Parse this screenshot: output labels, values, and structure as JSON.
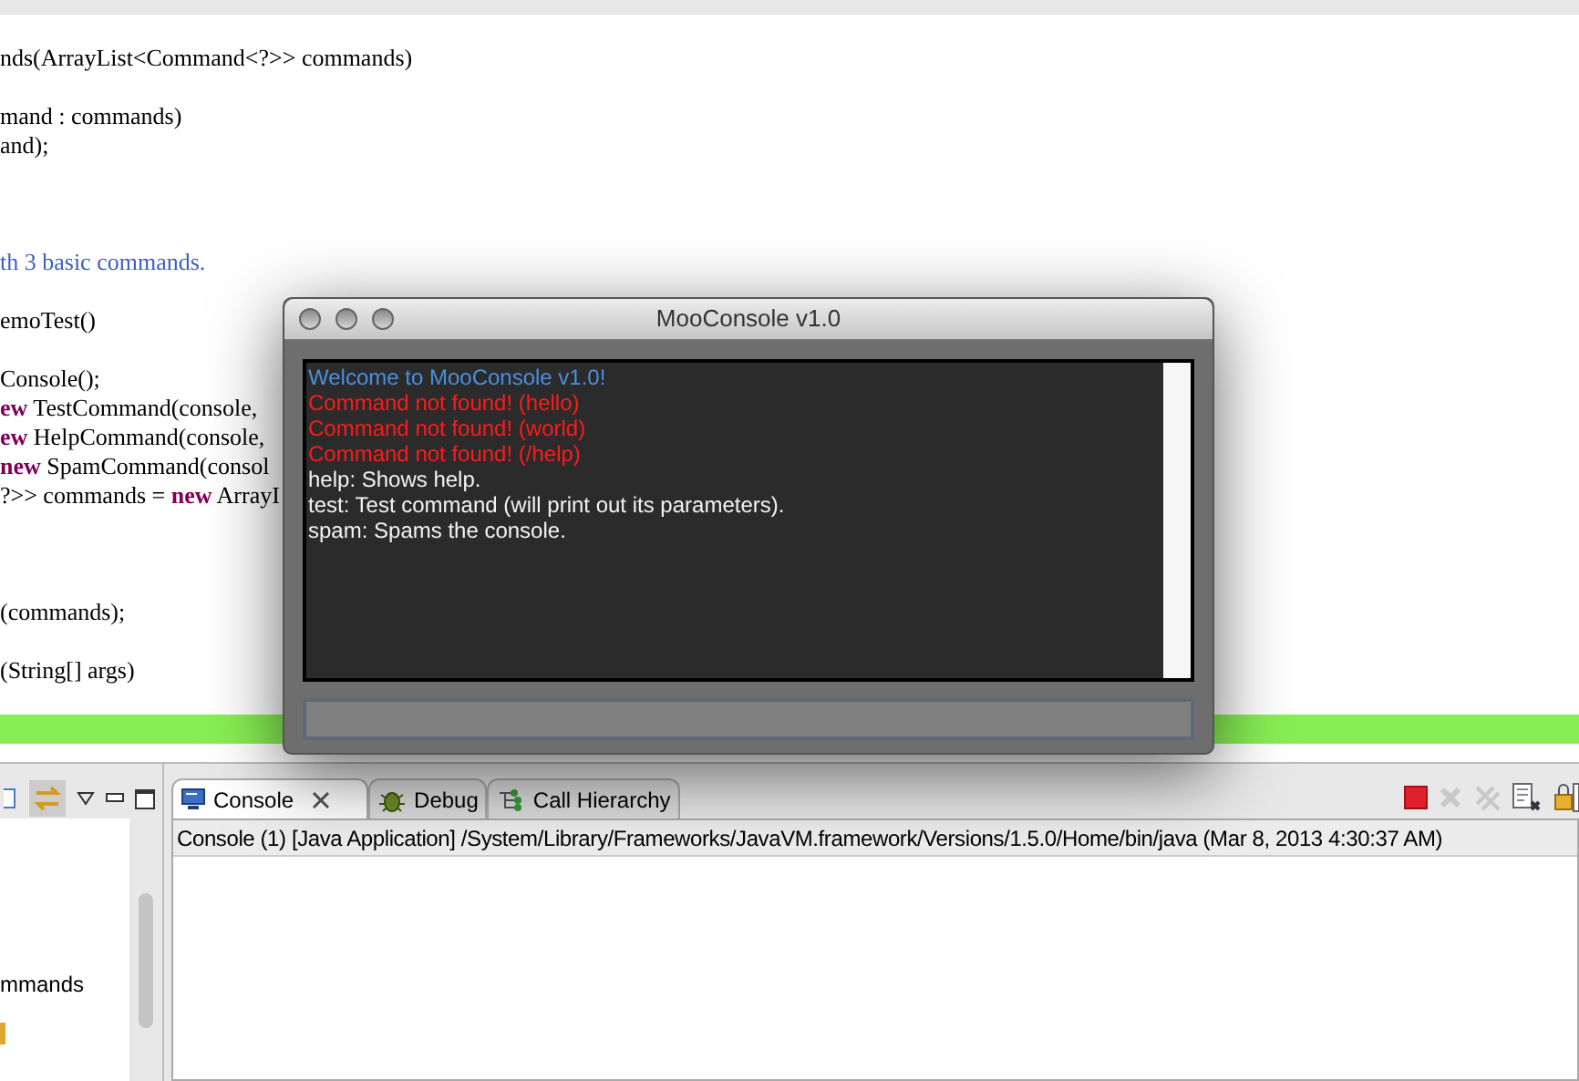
{
  "editor": {
    "lines": [
      {
        "current": false,
        "segments": [
          {
            "text": "nds(ArrayList<Command<?>> commands)",
            "kind": "plain"
          }
        ]
      },
      {
        "current": false
      },
      {
        "current": false,
        "segments": [
          {
            "text": "mand : commands)",
            "kind": "plain"
          }
        ]
      },
      {
        "current": false,
        "segments": [
          {
            "text": "and);",
            "kind": "plain"
          }
        ]
      },
      {
        "current": false
      },
      {
        "current": false
      },
      {
        "current": false
      },
      {
        "current": false,
        "segments": [
          {
            "text": "th 3 basic commands.",
            "kind": "comment"
          }
        ]
      },
      {
        "current": false
      },
      {
        "current": false,
        "segments": [
          {
            "text": "emoTest()",
            "kind": "plain"
          }
        ]
      },
      {
        "current": false
      },
      {
        "current": false,
        "segments": [
          {
            "text": "Console();",
            "kind": "plain"
          }
        ]
      },
      {
        "current": false,
        "segments": [
          {
            "text": "ew",
            "kind": "keyword"
          },
          {
            "text": " TestCommand(console,",
            "kind": "plain"
          }
        ]
      },
      {
        "current": false,
        "segments": [
          {
            "text": "ew",
            "kind": "keyword"
          },
          {
            "text": " HelpCommand(console,",
            "kind": "plain"
          }
        ]
      },
      {
        "current": false,
        "segments": [
          {
            "text": "new",
            "kind": "keyword"
          },
          {
            "text": " SpamCommand(consol",
            "kind": "plain"
          }
        ]
      },
      {
        "current": false,
        "segments": [
          {
            "text": "?>> commands = ",
            "kind": "plain"
          },
          {
            "text": "new",
            "kind": "keyword"
          },
          {
            "text": " ArrayI",
            "kind": "plain"
          }
        ]
      },
      {
        "current": false
      },
      {
        "current": false
      },
      {
        "current": false
      },
      {
        "current": false,
        "segments": [
          {
            "text": "(commands);",
            "kind": "plain"
          }
        ]
      },
      {
        "current": false
      },
      {
        "current": false,
        "segments": [
          {
            "text": "(String[] args)",
            "kind": "plain"
          }
        ]
      },
      {
        "current": false
      },
      {
        "current": true
      }
    ]
  },
  "dialog": {
    "title": "MooConsole v1.0",
    "log": [
      {
        "text": "Welcome to MooConsole v1.0!",
        "color": "#4a8fe0"
      },
      {
        "text": "Command not found! (hello)",
        "color": "#ff1a1a"
      },
      {
        "text": "Command not found! (world)",
        "color": "#ff1a1a"
      },
      {
        "text": "Command not found! (/help)",
        "color": "#ff1a1a"
      },
      {
        "text": "help: Shows help.",
        "color": "#f2f2f2"
      },
      {
        "text": "test: Test command (will print out its parameters).",
        "color": "#f2f2f2"
      },
      {
        "text": "spam: Spams the console.",
        "color": "#f2f2f2"
      }
    ]
  },
  "left_panel": {
    "item": "mmands"
  },
  "console_view": {
    "tabs": [
      {
        "label": "Console",
        "selected": true,
        "kind": "console"
      },
      {
        "label": "Debug",
        "selected": false,
        "kind": "debug"
      },
      {
        "label": "Call Hierarchy",
        "selected": false,
        "kind": "hierarchy"
      }
    ],
    "description": "Console (1) [Java Application] /System/Library/Frameworks/JavaVM.framework/Versions/1.5.0/Home/bin/java (Mar 8, 2013 4:30:37 AM)"
  }
}
